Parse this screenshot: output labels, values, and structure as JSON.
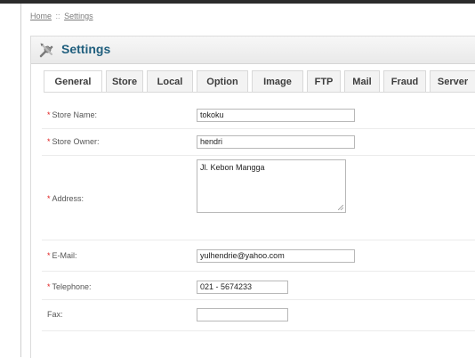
{
  "breadcrumb": {
    "home": "Home",
    "separator": "::",
    "current": "Settings"
  },
  "box": {
    "title": "Settings",
    "icon": "tools-icon"
  },
  "tabs": [
    {
      "label": "General",
      "active": true
    },
    {
      "label": "Store"
    },
    {
      "label": "Local"
    },
    {
      "label": "Option"
    },
    {
      "label": "Image"
    },
    {
      "label": "FTP"
    },
    {
      "label": "Mail"
    },
    {
      "label": "Fraud"
    },
    {
      "label": "Server"
    }
  ],
  "form": {
    "store_name": {
      "label": "Store Name:",
      "required": true,
      "value": "tokoku"
    },
    "store_owner": {
      "label": "Store Owner:",
      "required": true,
      "value": "hendri"
    },
    "address": {
      "label": "Address:",
      "required": true,
      "value": "Jl. Kebon Mangga"
    },
    "email": {
      "label": "E-Mail:",
      "required": true,
      "value": "yulhendrie@yahoo.com"
    },
    "telephone": {
      "label": "Telephone:",
      "required": true,
      "value": "021 - 5674233"
    },
    "fax": {
      "label": "Fax:",
      "required": false,
      "value": ""
    }
  },
  "colors": {
    "title": "#1f5e7d",
    "required_marker": "#e01b1b"
  }
}
